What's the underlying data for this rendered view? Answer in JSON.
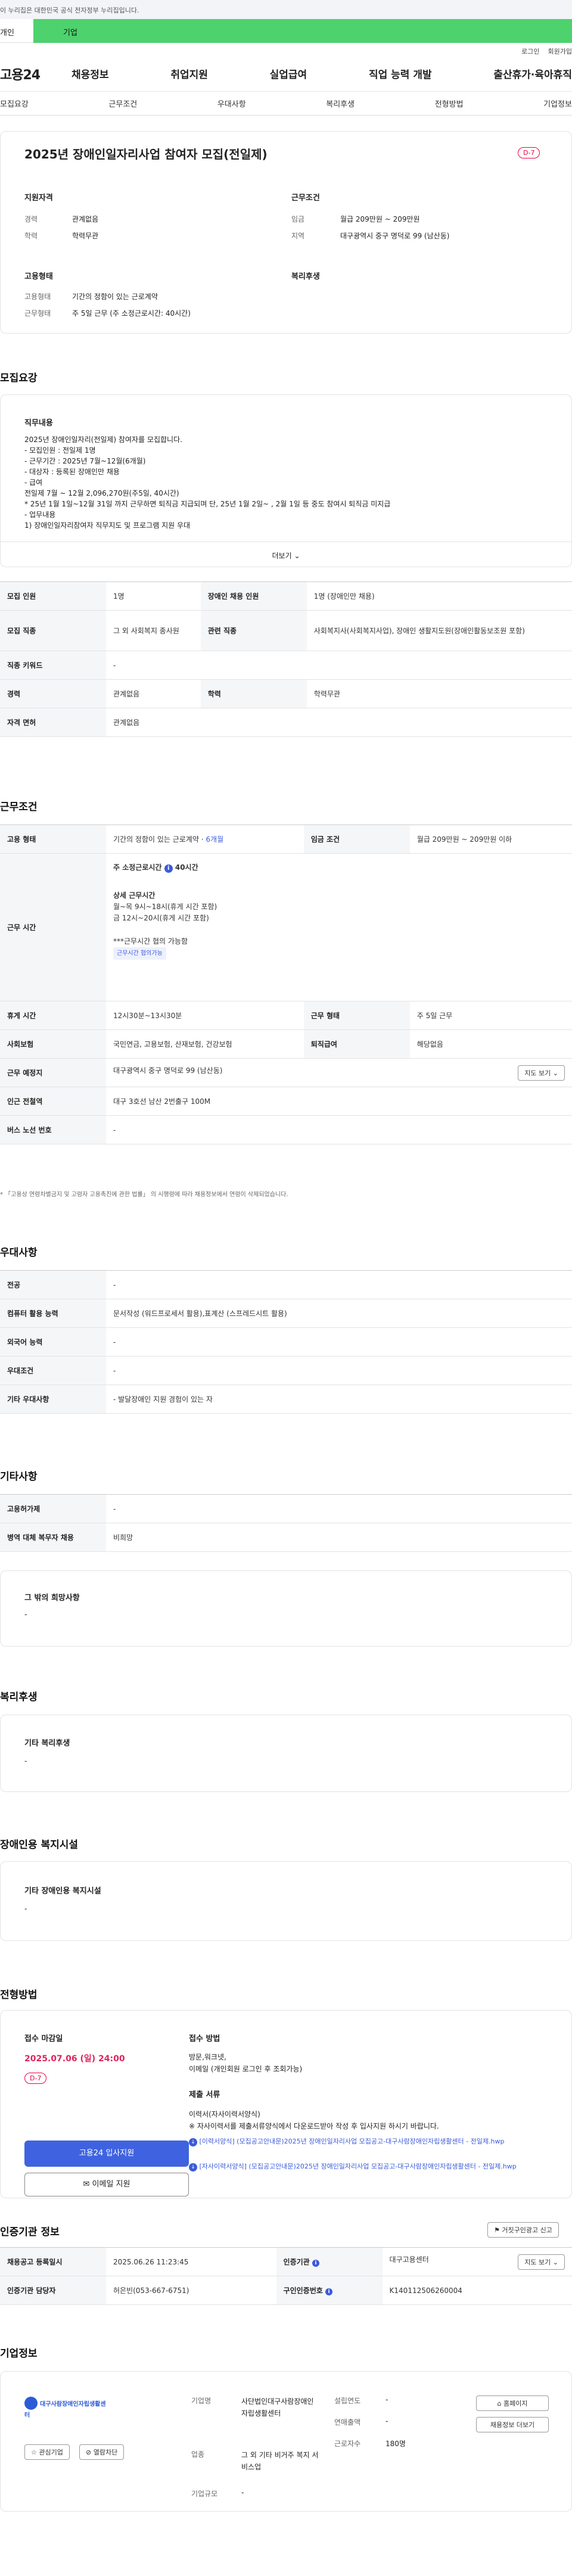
{
  "banner": "이 누리집은 대한민국 공식 전자정부 누리집입니다.",
  "top_tabs": [
    "개인",
    "기업"
  ],
  "util_links": [
    "로그인",
    "회원가입"
  ],
  "logo": "고용24",
  "gnb": [
    "채용정보",
    "취업지원",
    "실업급여",
    "직업 능력 개발",
    "출산휴가·육아휴직"
  ],
  "subnav": [
    "모집요강",
    "근무조건",
    "우대사항",
    "복리후생",
    "전형방법",
    "기업정보"
  ],
  "job": {
    "title": "2025년 장애인일자리사업 참여자 모집(전일제)",
    "dday": "D-7",
    "qual_title": "지원자격",
    "qual": [
      {
        "k": "경력",
        "v": "관계없음"
      },
      {
        "k": "학력",
        "v": "학력무관"
      }
    ],
    "cond_title": "근무조건",
    "cond": [
      {
        "k": "임금",
        "v": "월급 209만원 ~ 209만원"
      },
      {
        "k": "지역",
        "v": "대구광역시 중구 명덕로 99 (남산동)"
      }
    ],
    "emp_title": "고용형태",
    "emp": [
      {
        "k": "고용형태",
        "v": "기간의 정함이 있는 근로계약"
      },
      {
        "k": "근무형태",
        "v": "주 5일 근무 (주 소정근로시간: 40시간)"
      }
    ],
    "welfare_title": "복리후생"
  },
  "recruit": {
    "title": "모집요강",
    "duty_label": "직무내용",
    "duty_lines": [
      "2025년 장애인일자리(전일제) 참여자를 모집합니다.",
      "- 모집인원 : 전일제 1명",
      "- 근무기간 : 2025년 7월~12월(6개월)",
      "- 대상자 : 등록된 장애인만 채용",
      "- 급여",
      "  전일제 7월 ~ 12월 2,096,270원(주5일, 40시간)",
      "* 25년 1월 1일~12월 31일 까지 근무하면 퇴직금 지급되며 단, 25년 1월 2일~ , 2월 1일 등 중도 참여시 퇴직금 미지급",
      "- 업무내용",
      "  1) 장애인일자리참여자 직무지도 및 프로그램 지원  우대"
    ],
    "more": "더보기",
    "rows": [
      {
        "k1": "모집 인원",
        "v1": "1명",
        "k2": "장애인 채용 인원",
        "v2": "1명 (장애인만 채용)"
      },
      {
        "k1": "모집 직종",
        "v1": "그 외 사회복지 종사원",
        "k2": "관련 직종",
        "v2": "사회복지사(사회복지사업), 장애인 생활지도원(장애인활동보조원 포함)"
      },
      {
        "k1": "직종 키워드",
        "v1": "-",
        "k2": "",
        "v2": ""
      },
      {
        "k1": "경력",
        "v1": "관계없음",
        "k2": "학력",
        "v2": "학력무관"
      },
      {
        "k1": "자격 면허",
        "v1": "관계없음",
        "k2": "",
        "v2": ""
      }
    ]
  },
  "work": {
    "title": "근무조건",
    "emp_k": "고용 형태",
    "emp_v": "기간의 정함이 있는 근로계약",
    "emp_months": "6개월",
    "wage_k": "임금 조건",
    "wage_v": "월급 209만원 ~ 209만원 이하",
    "time_k": "근무 시간",
    "time_week": "주 소정근로시간",
    "time_hours": "40시간",
    "detail_title": "상세 근무시간",
    "detail_lines": [
      "월~목 9시~18시(휴게 시간 포함)",
      "금 12시~20시(휴게 시간 포함)"
    ],
    "consult": "***근무시간 협의 가능함",
    "consult_tag": "근무시간 협의가능",
    "rest_k": "휴게 시간",
    "rest_v": "12시30분~13시30분",
    "shift_k": "근무 형태",
    "shift_v": "주 5일 근무",
    "ins_k": "사회보험",
    "ins_v": "국민연금, 고용보험, 산재보험, 건강보험",
    "sev_k": "퇴직급여",
    "sev_v": "해당없음",
    "place_k": "근무 예정지",
    "place_v": "대구광역시 중구 명덕로 99 (남산동)",
    "map_btn": "지도 보기",
    "subway_k": "인근 전철역",
    "subway_v": "대구 3호선 남산 2번출구 100M",
    "bus_k": "버스 노선 번호",
    "bus_v": "-",
    "note": "* 「고용상 연령차별금지 및 고령자 고용촉진에 관한 법률」 의 시행령에 따라 채용정보에서 연령이 삭제되었습니다."
  },
  "pref": {
    "title": "우대사항",
    "rows": [
      {
        "k": "전공",
        "v": "-"
      },
      {
        "k": "컴퓨터 활용 능력",
        "v": "문서작성 (워드프로세서 활용),표계산 (스프레드시트 활용)"
      },
      {
        "k": "외국어 능력",
        "v": "-"
      },
      {
        "k": "우대조건",
        "v": "-"
      },
      {
        "k": "기타 우대사항",
        "v": "- 발달장애인 지원 경험이 있는 자"
      }
    ]
  },
  "etc": {
    "title": "기타사항",
    "rows": [
      {
        "k": "고용허가제",
        "v": "-"
      },
      {
        "k": "병역 대체 복무자 채용",
        "v": "비희망"
      }
    ],
    "hope_label": "그 밖의 희망사항",
    "hope_v": "-"
  },
  "welfare": {
    "title": "복리후생",
    "label": "기타 복리후생",
    "v": "-"
  },
  "facility": {
    "title": "장애인용 복지시설",
    "label": "기타 장애인용 복지시설",
    "v": "-"
  },
  "process": {
    "title": "전형방법",
    "deadline_label": "접수 마감일",
    "deadline": "2025.07.06 (일) 24:00",
    "dday": "D-7",
    "apply_btn": "고용24 입사지원",
    "email_btn": "이메일 지원",
    "method_label": "접수 방법",
    "method_lines": [
      "방문,워크넷,",
      "이메일 (개인회원 로그인 후 조회가능)"
    ],
    "docs_label": "제출 서류",
    "docs_lines": [
      "이력서(자사이력서양식)",
      "※ 자사이력서를 제출서류양식에서 다운로드받아 작성 후 입사지원 하시기 바랍니다."
    ],
    "files": [
      "[이력서양식] (모집공고안내문)2025년 장애인일자리사업 모집공고-대구사람장애인자립생활센터 - 전일제.hwp",
      "[자사이력서양식] (모집공고안내문)2025년 장애인일자리사업 모집공고-대구사람장애인자립생활센터 - 전일제.hwp"
    ]
  },
  "cert": {
    "title": "인증기관 정보",
    "report_btn": "거짓구인광고 신고",
    "rows": [
      {
        "k1": "채용공고 등록일시",
        "v1": "2025.06.26 11:23:45",
        "k2": "인증기관",
        "v2": "대구고용센터"
      },
      {
        "k1": "인증기관 담당자",
        "v1": "허은빈(053-667-6751)",
        "k2": "구인인증번호",
        "v2": "K140112506260004"
      }
    ],
    "map_btn": "지도 보기"
  },
  "company": {
    "title": "기업정보",
    "logo_text": "대구사람장애인자립생활센터",
    "fav_btn": "관심기업",
    "block_btn": "열람차단",
    "info": [
      {
        "k": "기업명",
        "v": "사단법인대구사람장애인자립생활센터"
      },
      {
        "k": "업종",
        "v": "그 외 기타 비거주 복지 서비스업"
      },
      {
        "k": "기업규모",
        "v": "-"
      }
    ],
    "info2": [
      {
        "k": "설립연도",
        "v": "-"
      },
      {
        "k": "연매출액",
        "v": "-"
      },
      {
        "k": "근로자수",
        "v": "180명"
      }
    ],
    "home_btn": "홈페이지",
    "other_btn": "채용정보 더보기"
  },
  "colors": {
    "accent": "#4dd26e",
    "dday": "#e0245e",
    "primary_btn": "#3f63e0",
    "link": "#3b5bdb"
  }
}
